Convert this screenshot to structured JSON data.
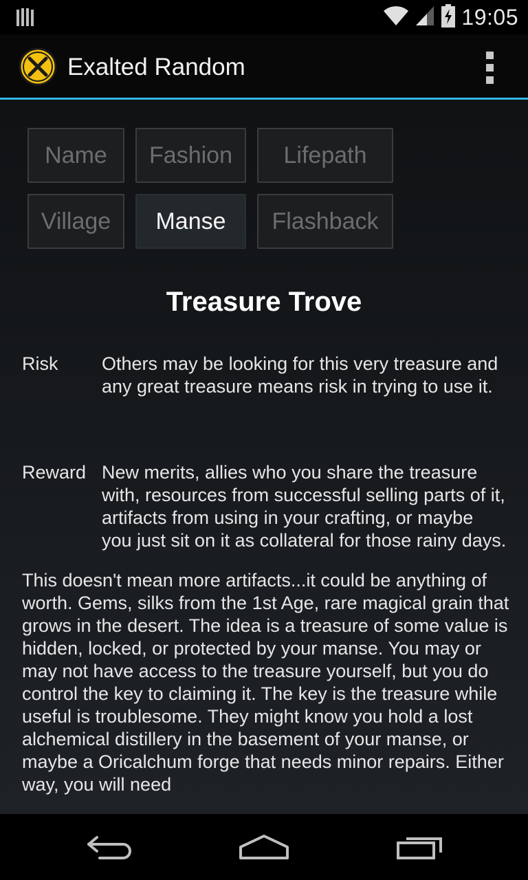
{
  "status_bar": {
    "time": "19:05",
    "icons": [
      "notification-bars-icon",
      "wifi-icon",
      "cell-signal-icon",
      "battery-charging-icon"
    ]
  },
  "action_bar": {
    "app_icon": "exalted-x-logo-icon",
    "title": "Exalted Random",
    "overflow_icon": "overflow-menu-icon",
    "accent_color": "#33b5e5"
  },
  "tabs": [
    {
      "label": "Name",
      "selected": false
    },
    {
      "label": "Fashion",
      "selected": false
    },
    {
      "label": "Lifepath",
      "selected": false
    },
    {
      "label": "Village",
      "selected": false
    },
    {
      "label": "Manse",
      "selected": true
    },
    {
      "label": "Flashback",
      "selected": false
    }
  ],
  "result": {
    "title": "Treasure Trove",
    "risk_label": "Risk",
    "risk_text": "Others may be looking for this very treasure and any great treasure means risk in trying to use it.",
    "reward_label": "Reward",
    "reward_text": "New merits, allies who you share the treasure with, resources from successful selling parts of it, artifacts from using in your crafting, or maybe you just sit on it as collateral for those rainy days.",
    "description": "This doesn't mean more artifacts...it could be anything of worth. Gems, silks from the 1st Age, rare magical grain that grows in the desert. The idea is a treasure of some value is hidden, locked, or protected by your manse. You may or may not have access to the treasure yourself, but you do control the key to claiming it. The key is the treasure while useful is troublesome. They might know you hold a lost alchemical distillery in the basement of your manse, or maybe a Oricalchum forge that needs minor repairs. Either way, you will need"
  },
  "nav_bar": {
    "icons": [
      "back-icon",
      "home-icon",
      "recent-apps-icon"
    ]
  }
}
